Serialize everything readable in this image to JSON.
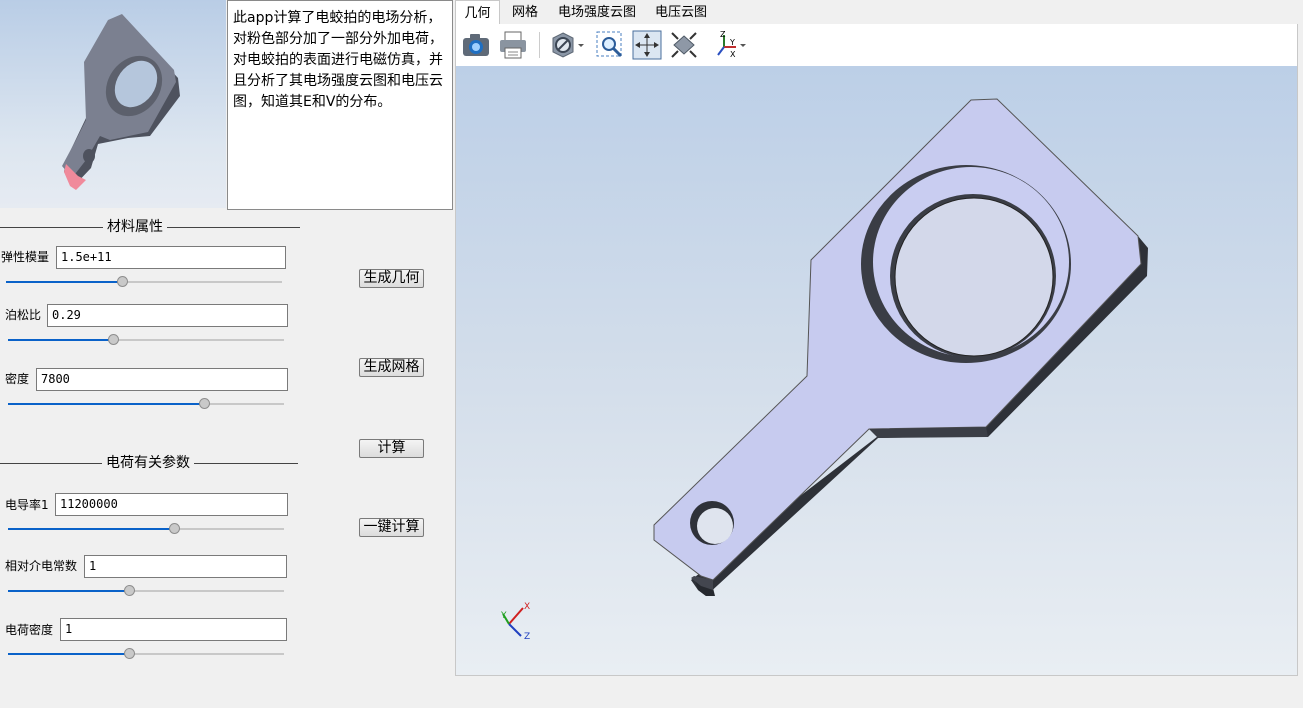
{
  "description": "此app计算了电蛟拍的电场分析，对粉色部分加了一部分外加电荷，对电蛟拍的表面进行电磁仿真，并且分析了其电场强度云图和电压云图，知道其E和V的分布。",
  "material": {
    "title": "材料属性",
    "elastic_modulus": {
      "label": "弹性模量",
      "value": "1.5e+11",
      "slider": 0.42
    },
    "poisson_ratio": {
      "label": "泊松比",
      "value": "0.29",
      "slider": 0.38
    },
    "density": {
      "label": "密度",
      "value": "7800",
      "slider": 0.71
    }
  },
  "charge": {
    "title": "电荷有关参数",
    "conductivity": {
      "label": "电导率1",
      "value": "11200000",
      "slider": 0.6
    },
    "permittivity": {
      "label": "相对介电常数",
      "value": "1",
      "slider": 0.44
    },
    "charge_density": {
      "label": "电荷密度",
      "value": "1",
      "slider": 0.44
    }
  },
  "buttons": {
    "gen_geometry": "生成几何",
    "gen_mesh": "生成网格",
    "compute": "计算",
    "one_click": "一键计算"
  },
  "tabs": [
    {
      "label": "几何",
      "active": true
    },
    {
      "label": "网格",
      "active": false
    },
    {
      "label": "电场强度云图",
      "active": false
    },
    {
      "label": "电压云图",
      "active": false
    }
  ],
  "toolbar_icons": [
    "camera-icon",
    "printer-icon",
    "render-mode-icon",
    "zoom-box-icon",
    "zoom-fit-icon",
    "view-fit-icon",
    "axis-orientation-icon"
  ],
  "axes": {
    "x": "X",
    "y": "Y",
    "z": "Z"
  },
  "colors": {
    "highlight": "#f08a9b",
    "active_fill": "#0a62c9",
    "model_face": "#c9cdf0"
  }
}
